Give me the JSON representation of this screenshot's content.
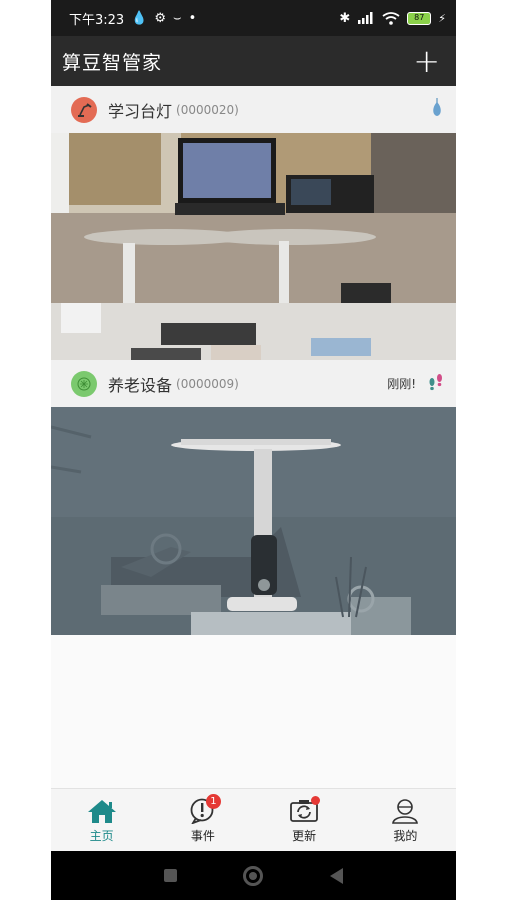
{
  "status_bar": {
    "time": "下午3:23",
    "battery": "87"
  },
  "app_bar": {
    "title": "算豆智管家",
    "add_label": "+"
  },
  "devices": [
    {
      "name": "学习台灯",
      "code": "(0000020)",
      "time": ""
    },
    {
      "name": "养老设备",
      "code": "(0000009)",
      "time": "刚刚!"
    }
  ],
  "tabs": [
    {
      "label": "主页",
      "active": true
    },
    {
      "label": "事件",
      "badge": "1"
    },
    {
      "label": "更新",
      "dot": true
    },
    {
      "label": "我的"
    }
  ],
  "colors": {
    "accent": "#1e8a8a",
    "badge": "#e53935",
    "appbar": "#2b2b2b"
  }
}
